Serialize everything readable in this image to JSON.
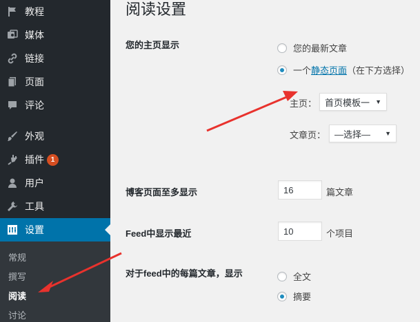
{
  "sidebar": {
    "items": [
      {
        "label": "教程",
        "icon": "flag-icon"
      },
      {
        "label": "媒体",
        "icon": "media-icon"
      },
      {
        "label": "链接",
        "icon": "link-icon"
      },
      {
        "label": "页面",
        "icon": "page-icon"
      },
      {
        "label": "评论",
        "icon": "comment-icon"
      },
      {
        "label": "外观",
        "icon": "brush-icon"
      },
      {
        "label": "插件",
        "icon": "plugin-icon",
        "badge": "1"
      },
      {
        "label": "用户",
        "icon": "user-icon"
      },
      {
        "label": "工具",
        "icon": "wrench-icon"
      },
      {
        "label": "设置",
        "icon": "settings-icon"
      }
    ],
    "submenu": [
      "常规",
      "撰写",
      "阅读",
      "讨论"
    ],
    "colors": {
      "background": "#23282d",
      "active": "#0073aa",
      "submenu": "#32373c",
      "badge": "#d54e21"
    }
  },
  "main": {
    "title": "阅读设置",
    "front_page": {
      "label": "您的主页显示",
      "option_latest": "您的最新文章",
      "option_static_prefix": "一个",
      "option_static_link": "静态页面",
      "option_static_suffix": "（在下方选择）",
      "homepage_label": "主页：",
      "homepage_value": "首页模板一",
      "posts_page_label": "文章页：",
      "posts_page_value": "—选择—"
    },
    "posts_per_page": {
      "label": "博客页面至多显示",
      "value": "16",
      "unit": "篇文章"
    },
    "feed_recent": {
      "label": "Feed中显示最近",
      "value": "10",
      "unit": "个项目"
    },
    "feed_content": {
      "label": "对于feed中的每篇文章，显示",
      "option_full": "全文",
      "option_summary": "摘要"
    }
  },
  "annotation_color": "#e8322d"
}
